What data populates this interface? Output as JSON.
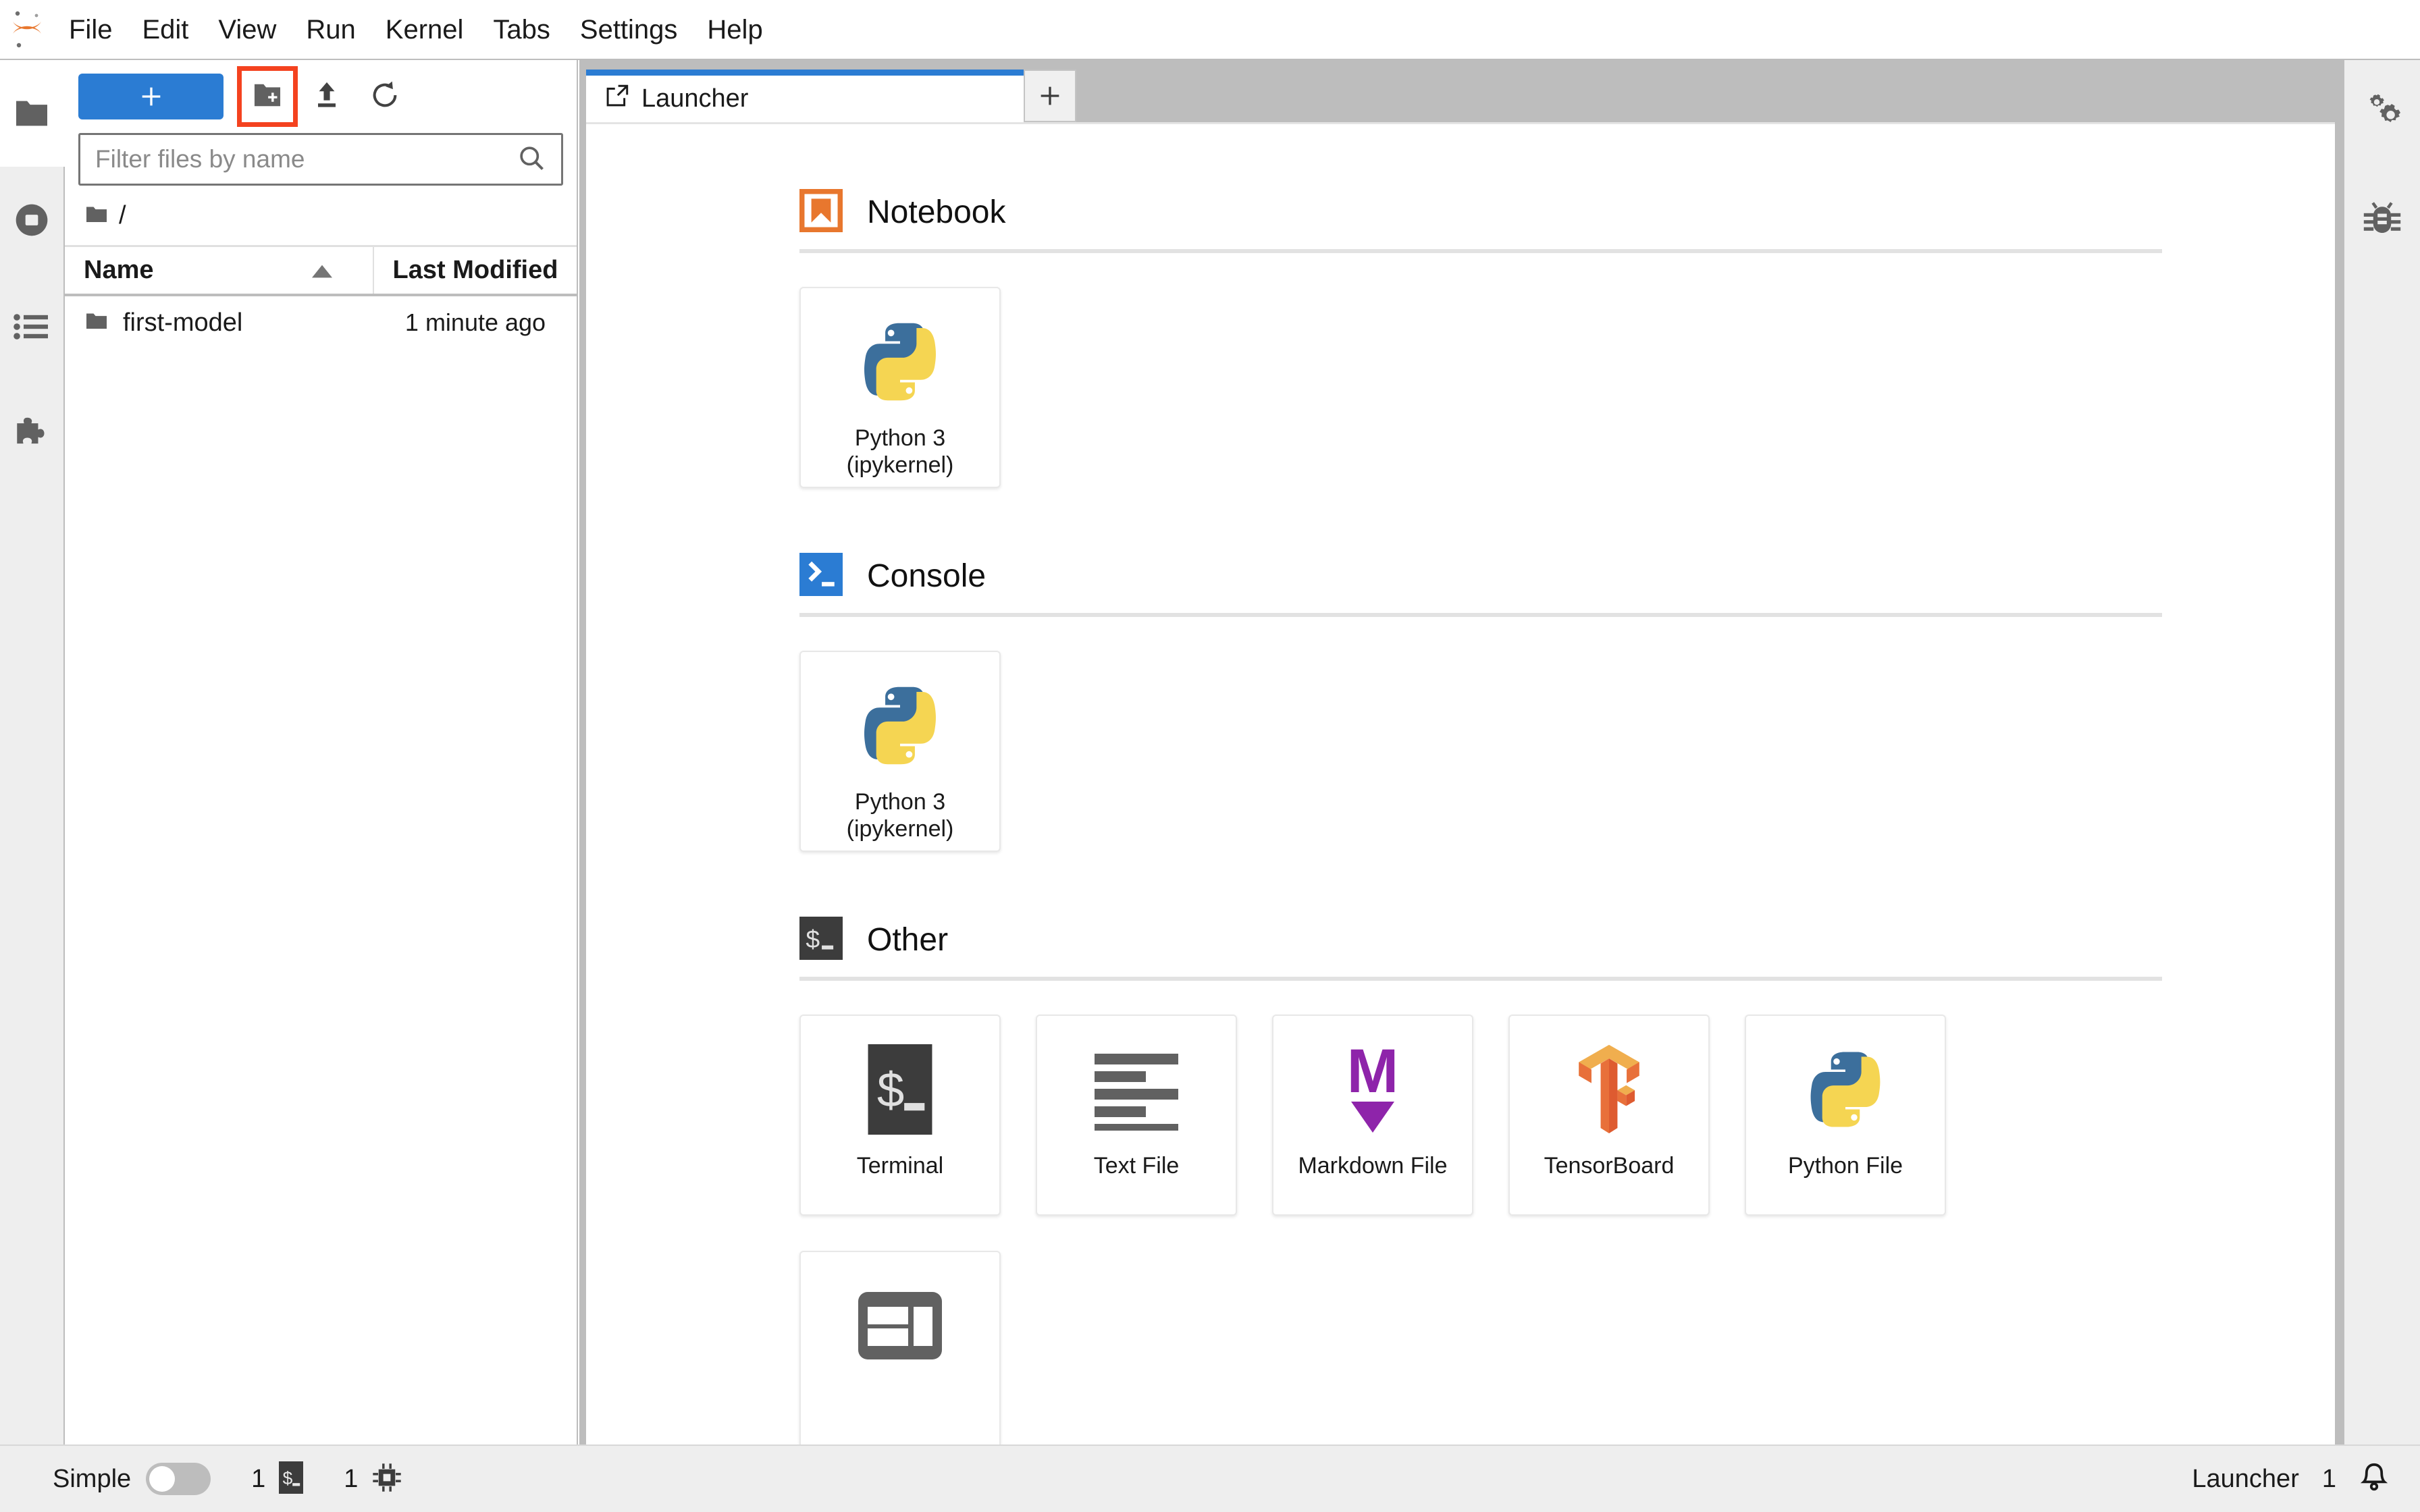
{
  "app": {
    "logo_icon": "jupyter-logo-icon"
  },
  "menubar": {
    "items": [
      {
        "label": "File",
        "name": "menu-file"
      },
      {
        "label": "Edit",
        "name": "menu-edit"
      },
      {
        "label": "View",
        "name": "menu-view"
      },
      {
        "label": "Run",
        "name": "menu-run"
      },
      {
        "label": "Kernel",
        "name": "menu-kernel"
      },
      {
        "label": "Tabs",
        "name": "menu-tabs"
      },
      {
        "label": "Settings",
        "name": "menu-settings"
      },
      {
        "label": "Help",
        "name": "menu-help"
      }
    ]
  },
  "left_rail": {
    "items": [
      {
        "icon": "folder-icon",
        "name": "sidebar-item-file-browser",
        "active": true
      },
      {
        "icon": "running-terminals-icon",
        "name": "sidebar-item-running",
        "active": false
      },
      {
        "icon": "table-of-contents-icon",
        "name": "sidebar-item-toc",
        "active": false
      },
      {
        "icon": "puzzle-extension-icon",
        "name": "sidebar-item-extensions",
        "active": false
      }
    ]
  },
  "right_rail": {
    "items": [
      {
        "icon": "property-inspector-gears-icon",
        "name": "sidebar-item-property-inspector"
      },
      {
        "icon": "debugger-bug-icon",
        "name": "sidebar-item-debugger"
      }
    ]
  },
  "filebrowser": {
    "toolbar": {
      "new_launcher_label": "+",
      "new_folder_icon": "new-folder-icon",
      "upload_icon": "upload-icon",
      "refresh_icon": "refresh-icon",
      "new_folder_highlighted": true,
      "highlight_color": "#f4421f"
    },
    "filter": {
      "placeholder": "Filter files by name",
      "value": "",
      "icon": "search-icon"
    },
    "breadcrumb": {
      "root_icon": "folder-icon",
      "path": "/"
    },
    "columns": [
      {
        "label": "Name",
        "sort": "ascending"
      },
      {
        "label": "Last Modified",
        "sort": null
      }
    ],
    "rows": [
      {
        "icon": "folder-icon",
        "name": "first-model",
        "last_modified": "1 minute ago"
      }
    ]
  },
  "dock": {
    "tabs": [
      {
        "label": "Launcher",
        "icon": "launcher-icon",
        "active": true
      }
    ],
    "add_tab_label": "+"
  },
  "launcher": {
    "sections": [
      {
        "title": "Notebook",
        "icon": "notebook-bookmark-icon",
        "cards": [
          {
            "label": "Python 3\n(ipykernel)",
            "label_line1": "Python 3",
            "label_line2": "(ipykernel)",
            "icon": "python-logo-icon"
          }
        ]
      },
      {
        "title": "Console",
        "icon": "console-prompt-icon",
        "cards": [
          {
            "label": "Python 3\n(ipykernel)",
            "label_line1": "Python 3",
            "label_line2": "(ipykernel)",
            "icon": "python-logo-icon"
          }
        ]
      },
      {
        "title": "Other",
        "icon": "terminal-dollar-icon",
        "cards": [
          {
            "label": "Terminal",
            "label_line1": "Terminal",
            "label_line2": "",
            "icon": "terminal-dollar-icon"
          },
          {
            "label": "Text File",
            "label_line1": "Text File",
            "label_line2": "",
            "icon": "text-file-lines-icon"
          },
          {
            "label": "Markdown File",
            "label_line1": "Markdown File",
            "label_line2": "",
            "icon": "markdown-m-icon"
          },
          {
            "label": "TensorBoard",
            "label_line1": "TensorBoard",
            "label_line2": "",
            "icon": "tensorboard-logo-icon"
          },
          {
            "label": "Python File",
            "label_line1": "Python File",
            "label_line2": "",
            "icon": "python-logo-icon"
          }
        ],
        "cards_row2": [
          {
            "label": "",
            "label_line1": "",
            "label_line2": "",
            "icon": "show-contextual-help-icon"
          }
        ]
      }
    ]
  },
  "statusbar": {
    "simple_label": "Simple",
    "simple_toggle_on": false,
    "terminals_count": "1",
    "terminals_icon": "terminal-dollar-icon",
    "kernels_count": "1",
    "kernels_icon": "kernel-chip-icon",
    "active_tab_label": "Launcher",
    "notifications_count": "1",
    "notifications_icon": "bell-icon"
  },
  "colors": {
    "accent_blue": "#2b7cd3",
    "highlight_red": "#f4421f",
    "notebook_orange": "#e8772e",
    "markdown_purple": "#8e24aa",
    "python_blue": "#3c6f9c",
    "python_yellow": "#f5d552",
    "chrome_gray": "#bdbdbd",
    "rail_gray": "#eeeeee"
  }
}
